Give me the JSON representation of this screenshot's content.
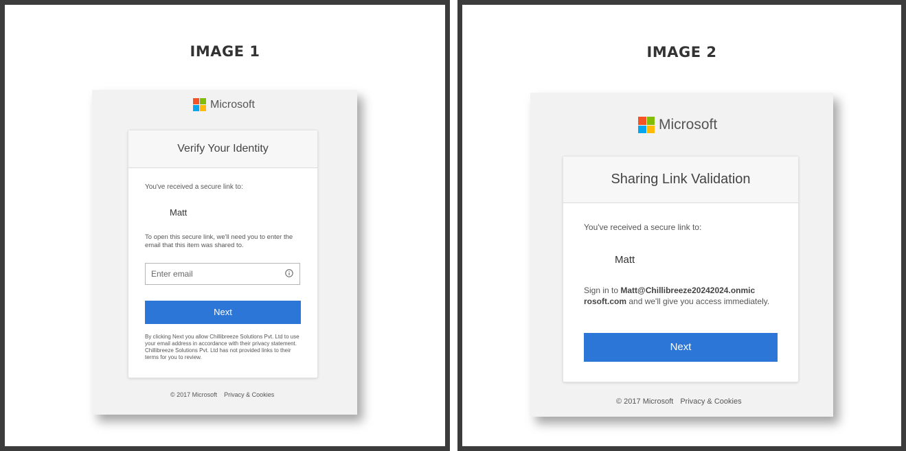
{
  "panel1": {
    "title": "IMAGE 1",
    "logo_text": "Microsoft",
    "card": {
      "header": "Verify Your Identity",
      "received_text": "You've received a secure link to:",
      "name": "Matt",
      "instruction": "To open this secure link, we'll need you to enter the email that this item was shared to.",
      "email_placeholder": "Enter email",
      "next_label": "Next",
      "legal": "By clicking Next you allow Chillibreeze Solutions Pvt. Ltd to use your email address in accordance with their privacy statement. Chillibreeze Solutions Pvt. Ltd has not provided links to their terms for you to review."
    },
    "footer": {
      "copyright": "© 2017 Microsoft",
      "privacy_link": "Privacy & Cookies"
    }
  },
  "panel2": {
    "title": "IMAGE 2",
    "logo_text": "Microsoft",
    "card": {
      "header": "Sharing Link Validation",
      "received_text": "You've received a secure link to:",
      "name": "Matt",
      "signin_prefix": "Sign in to ",
      "signin_email_line1": "Matt@Chillibreeze20242024.onmic",
      "signin_email_line2": "rosoft.com",
      "signin_suffix": " and we'll give you access immediately.",
      "next_label": "Next"
    },
    "footer": {
      "copyright": "© 2017 Microsoft",
      "privacy_link": "Privacy & Cookies"
    }
  },
  "colors": {
    "button": "#2b76d6",
    "logo_red": "#f35325",
    "logo_green": "#81bc06",
    "logo_blue": "#05a6f0",
    "logo_yellow": "#ffba08"
  }
}
